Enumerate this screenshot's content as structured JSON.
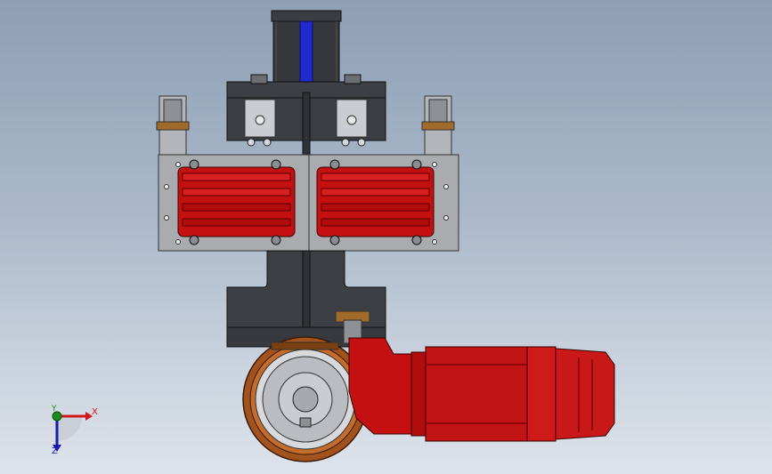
{
  "viewport": {
    "background_top": "#8e9fb4",
    "background_bottom": "#dde3ea"
  },
  "model": {
    "colors": {
      "housing": "#3c3f44",
      "plate": "#a9abae",
      "cover": "#c41010",
      "motor": "#c21414",
      "tire": "#a2521c",
      "hub": "#b9bcc1",
      "shaft": "#1f2ad0"
    }
  },
  "triad": {
    "x_label": "X",
    "y_label": "Y",
    "z_label": "Z",
    "x_color": "#d01818",
    "y_color": "#1a8c1a",
    "z_color": "#1a1ab0"
  }
}
